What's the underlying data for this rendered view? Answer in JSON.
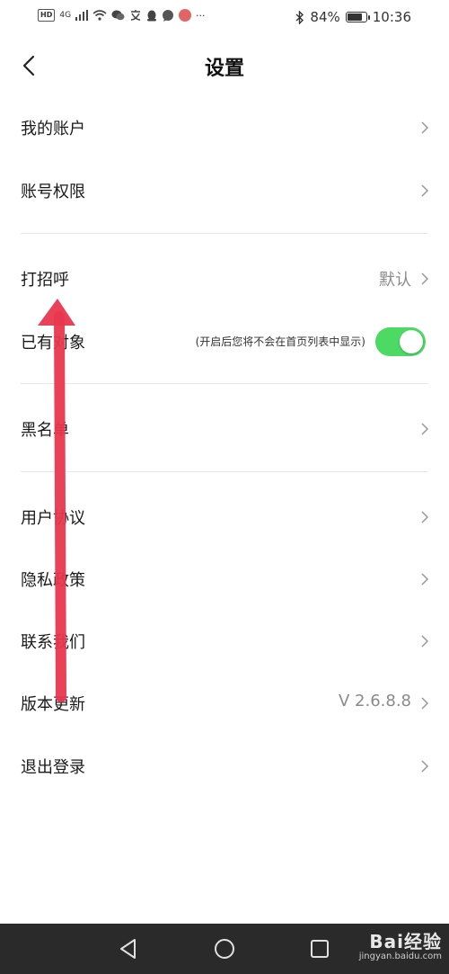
{
  "status_bar": {
    "network": "4G",
    "battery_percent": "84%",
    "battery_level": 0.84,
    "time": "10:36",
    "icons": [
      "hd-icon",
      "signal-icon",
      "wifi-icon",
      "wechat-icon",
      "translate-icon",
      "qq-icon",
      "chat-icon",
      "app-icon",
      "more-icon",
      "bluetooth-icon",
      "battery-icon"
    ],
    "more": "···"
  },
  "header": {
    "title": "设置"
  },
  "menu": {
    "my_account": "我的账户",
    "account_permissions": "账号权限",
    "greeting": "打招呼",
    "greeting_value": "默认",
    "has_partner": "已有对象",
    "has_partner_hint": "(开启后您将不会在首页列表中显示)",
    "has_partner_enabled": true,
    "blacklist": "黑名单",
    "user_agreement": "用户协议",
    "privacy_policy": "隐私政策",
    "contact_us": "联系我们",
    "version_update": "版本更新",
    "version_value": "V 2.6.8.8",
    "logout": "退出登录"
  },
  "colors": {
    "toggle_on": "#4cd964",
    "divider": "#e6e6e6",
    "arrow": "#e8384f",
    "nav_bg": "#2a2a2a"
  },
  "watermark": {
    "line1": "Bai经验",
    "line2": "jingyan.baidu.com"
  }
}
